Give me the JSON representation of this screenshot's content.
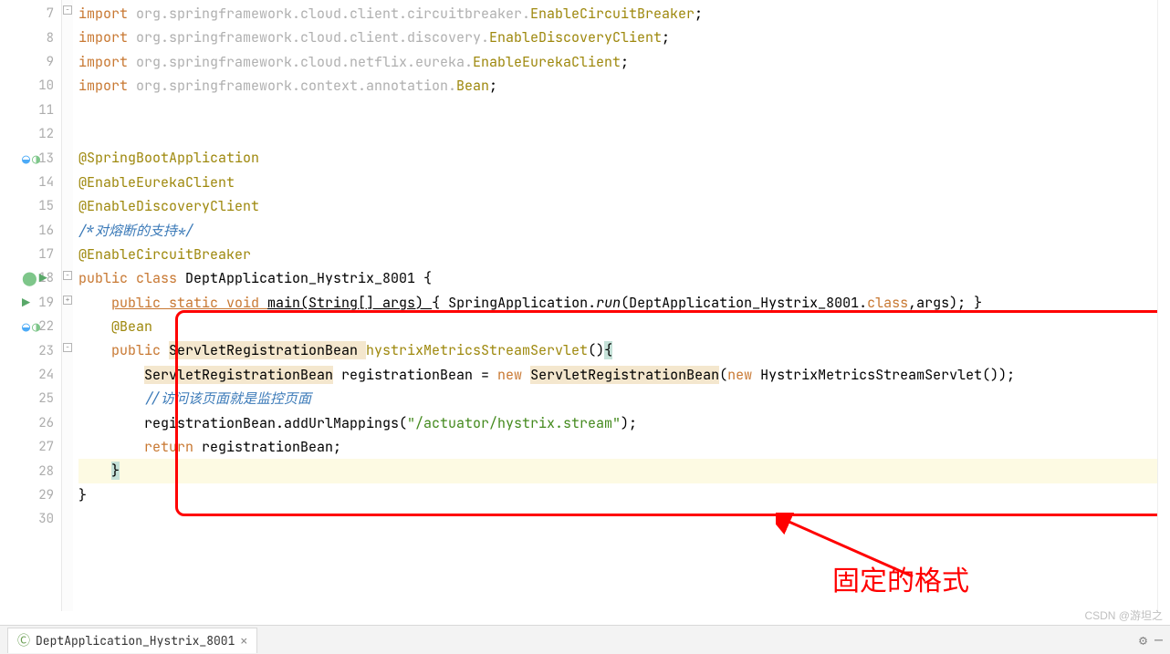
{
  "lines": {
    "7": "7",
    "8": "8",
    "9": "9",
    "10": "10",
    "11": "11",
    "12": "12",
    "13": "13",
    "14": "14",
    "15": "15",
    "16": "16",
    "17": "17",
    "18": "18",
    "19": "19",
    "22": "22",
    "23": "23",
    "24": "24",
    "25": "25",
    "26": "26",
    "27": "27",
    "28": "28",
    "29": "29",
    "30": "30"
  },
  "code": {
    "l7": {
      "kw": "import ",
      "pkg": "org.springframework.cloud.client.circuitbreaker.",
      "cls": "EnableCircuitBreaker",
      "end": ";"
    },
    "l8": {
      "kw": "import ",
      "pkg": "org.springframework.cloud.client.discovery.",
      "cls": "EnableDiscoveryClient",
      "end": ";"
    },
    "l9": {
      "kw": "import ",
      "pkg": "org.springframework.cloud.netflix.eureka.",
      "cls": "EnableEurekaClient",
      "end": ";"
    },
    "l10": {
      "kw": "import ",
      "pkg": "org.springframework.context.annotation.",
      "cls": "Bean",
      "end": ";"
    },
    "l13": {
      "anno": "@SpringBootApplication"
    },
    "l14": {
      "anno": "@EnableEurekaClient"
    },
    "l15": {
      "anno": "@EnableDiscoveryClient"
    },
    "l16": {
      "comment": "/*对熔断的支持*/"
    },
    "l17": {
      "anno": "@EnableCircuitBreaker"
    },
    "l18": {
      "kw1": "public class ",
      "cls": "DeptApplication_Hystrix_8001 ",
      "brace": "{"
    },
    "l19": {
      "indent": "    ",
      "kw1": "public static void ",
      "m": "main",
      "p1": "(String[] args) ",
      "b1": "{",
      "mid": " SpringApplication.",
      "run": "run",
      "p2": "(DeptApplication_Hystrix_8001.",
      "cl": "class",
      "p3": ",args); ",
      "b2": "}"
    },
    "l22": {
      "indent": "    ",
      "anno": "@Bean"
    },
    "l23": {
      "indent": "    ",
      "kw1": "public ",
      "type": "ServletRegistrationBean ",
      "m": "hystrixMetricsStreamServlet",
      "p": "()",
      "b": "{"
    },
    "l24": {
      "indent": "        ",
      "type1": "ServletRegistrationBean",
      "mid1": " registrationBean = ",
      "new1": "new ",
      "type2": "ServletRegistrationBean",
      "p1": "(",
      "new2": "new ",
      "ctor": "HystrixMetricsStreamServlet()",
      "p2": ");"
    },
    "l25": {
      "indent": "        ",
      "comment": "//访问该页面就是监控页面"
    },
    "l26": {
      "indent": "        ",
      "obj": "registrationBean.addUrlMappings(",
      "str": "\"/actuator/hystrix.stream\"",
      "end": ");"
    },
    "l27": {
      "indent": "        ",
      "kw": "return ",
      "rest": "registrationBean;"
    },
    "l28": {
      "indent": "    ",
      "b": "}"
    },
    "l29": {
      "b": "}"
    }
  },
  "annotation_label": "固定的格式",
  "tab": {
    "name": "DeptApplication_Hystrix_8001"
  },
  "watermark": "CSDN @游坦之"
}
